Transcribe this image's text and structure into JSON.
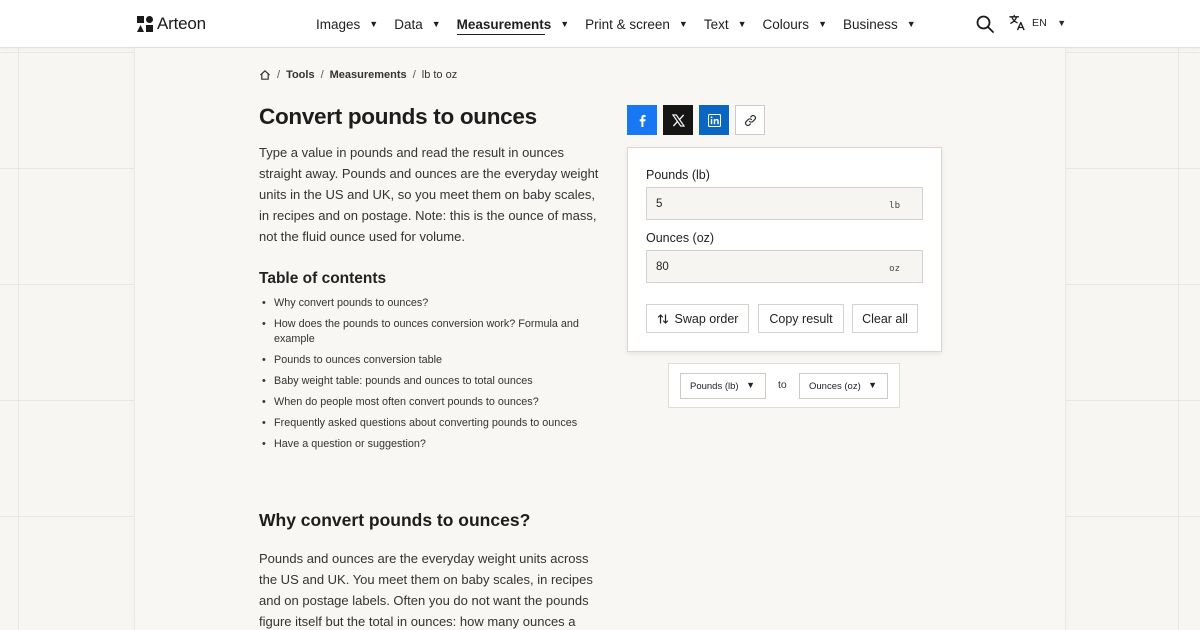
{
  "header": {
    "logo_text": "Arteon",
    "nav": [
      {
        "label": "Images",
        "active": false
      },
      {
        "label": "Data",
        "active": false
      },
      {
        "label": "Measurements",
        "active": true
      },
      {
        "label": "Print & screen",
        "active": false
      },
      {
        "label": "Text",
        "active": false
      },
      {
        "label": "Colours",
        "active": false
      },
      {
        "label": "Business",
        "active": false
      }
    ],
    "caret": "▼",
    "search_icon": "search-icon",
    "language": {
      "icon": "translate-icon",
      "code": "EN"
    }
  },
  "breadcrumb": {
    "home_icon": "home-icon",
    "separator": "/",
    "items": [
      "Tools",
      "Measurements",
      "lb to oz"
    ]
  },
  "article": {
    "title": "Convert pounds to ounces",
    "intro": "Type a value in pounds and read the result in ounces straight away. Pounds and ounces are the everyday weight units in the US and UK, so you meet them on baby scales, in recipes and on postage. Note: this is the ounce of mass, not the fluid ounce used for volume.",
    "toc_title": "Table of contents",
    "toc": [
      "Why convert pounds to ounces?",
      "How does the pounds to ounces conversion work? Formula and example",
      "Pounds to ounces conversion table",
      "Baby weight table: pounds and ounces to total ounces",
      "When do people most often convert pounds to ounces?",
      "Frequently asked questions about converting pounds to ounces",
      "Have a question or suggestion?"
    ],
    "section_title": "Why convert pounds to ounces?",
    "section_body": "Pounds and ounces are the everyday weight units across the US and UK. You meet them on baby scales, in recipes and on postage labels. Often you do not want the pounds figure itself but the total in ounces: how many ounces a"
  },
  "share": {
    "buttons": [
      "facebook-icon",
      "x-icon",
      "linkedin-icon",
      "link-icon"
    ],
    "colors": {
      "facebook": "#1877f2",
      "x": "#151515",
      "linkedin": "#0a66c2"
    }
  },
  "converter": {
    "from_label": "Pounds (lb)",
    "from_value": "5",
    "from_unit": "lb",
    "to_label": "Ounces (oz)",
    "to_value": "80",
    "to_unit": "oz",
    "swap_label": "Swap order",
    "copy_label": "Copy result",
    "clear_label": "Clear all"
  },
  "unit_selector": {
    "from": "Pounds (lb)",
    "to_word": "to",
    "to": "Ounces (oz)"
  }
}
